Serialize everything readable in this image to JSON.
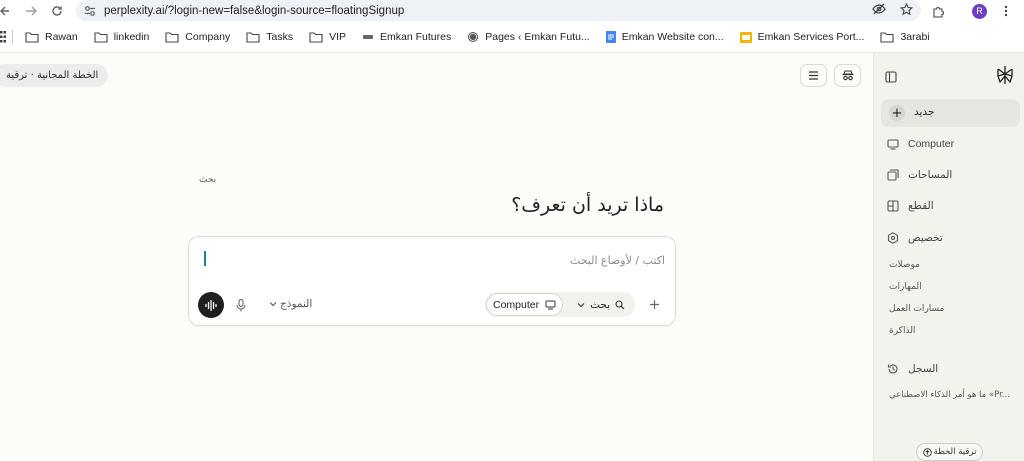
{
  "browser": {
    "url": "perplexity.ai/?login-new=false&login-source=floatingSignup",
    "profile_initial": "R",
    "bookmarks": [
      {
        "label": "Rawan",
        "icon": "folder-icon"
      },
      {
        "label": "linkedin",
        "icon": "folder-icon"
      },
      {
        "label": "Company",
        "icon": "folder-icon"
      },
      {
        "label": "Tasks",
        "icon": "folder-icon"
      },
      {
        "label": "VIP",
        "icon": "folder-icon"
      },
      {
        "label": "Emkan Futures",
        "icon": "site-icon"
      },
      {
        "label": "Pages ‹ Emkan Futu...",
        "icon": "wordpress-icon"
      },
      {
        "label": "Emkan Website con...",
        "icon": "docs-icon"
      },
      {
        "label": "Emkan Services Port...",
        "icon": "slides-icon"
      },
      {
        "label": "3arabi",
        "icon": "folder-icon"
      }
    ]
  },
  "header": {
    "plan_pill": "الخطة المجانية · ترقية"
  },
  "main": {
    "tiny_label": "بحث",
    "headline": "ماذا تريد أن تعرف؟",
    "composer": {
      "placeholder": "اكتب / لأوضاع البحث",
      "model_label": "النموذج",
      "mode_computer": "Computer",
      "mode_search": "بحث"
    }
  },
  "sidebar": {
    "new_label": "جديد",
    "items": [
      {
        "label": "Computer",
        "icon": "computer-icon"
      },
      {
        "label": "المساحات",
        "icon": "spaces-icon"
      },
      {
        "label": "القطع",
        "icon": "artifacts-icon"
      },
      {
        "label": "تخصيص",
        "icon": "customize-icon"
      }
    ],
    "sub_items": [
      "موصلات",
      "المهارات",
      "مسارات العمل",
      "الذاكرة"
    ],
    "history_label": "السجل",
    "history_entries": [
      "ما هو أمر الذكاء الاصطناعي «Pr..."
    ],
    "upgrade_label": "ترقية الخطة"
  },
  "colors": {
    "accent": "#20808d",
    "profile": "#6c3fc5",
    "main_bg": "#fcfcf9",
    "sidebar_bg": "#f3f3ee"
  }
}
